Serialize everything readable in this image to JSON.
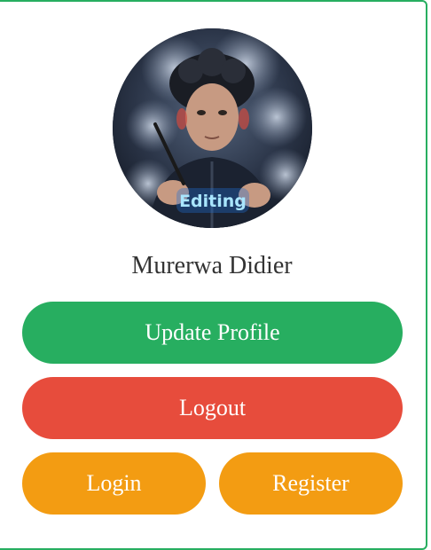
{
  "profile": {
    "name": "Murerwa Didier",
    "avatar_caption": "Editing"
  },
  "actions": {
    "update_profile": "Update Profile",
    "logout": "Logout",
    "login": "Login",
    "register": "Register"
  },
  "colors": {
    "border": "#27ae60",
    "update": "#27ae60",
    "logout": "#e74c3c",
    "auth": "#f39c12"
  }
}
